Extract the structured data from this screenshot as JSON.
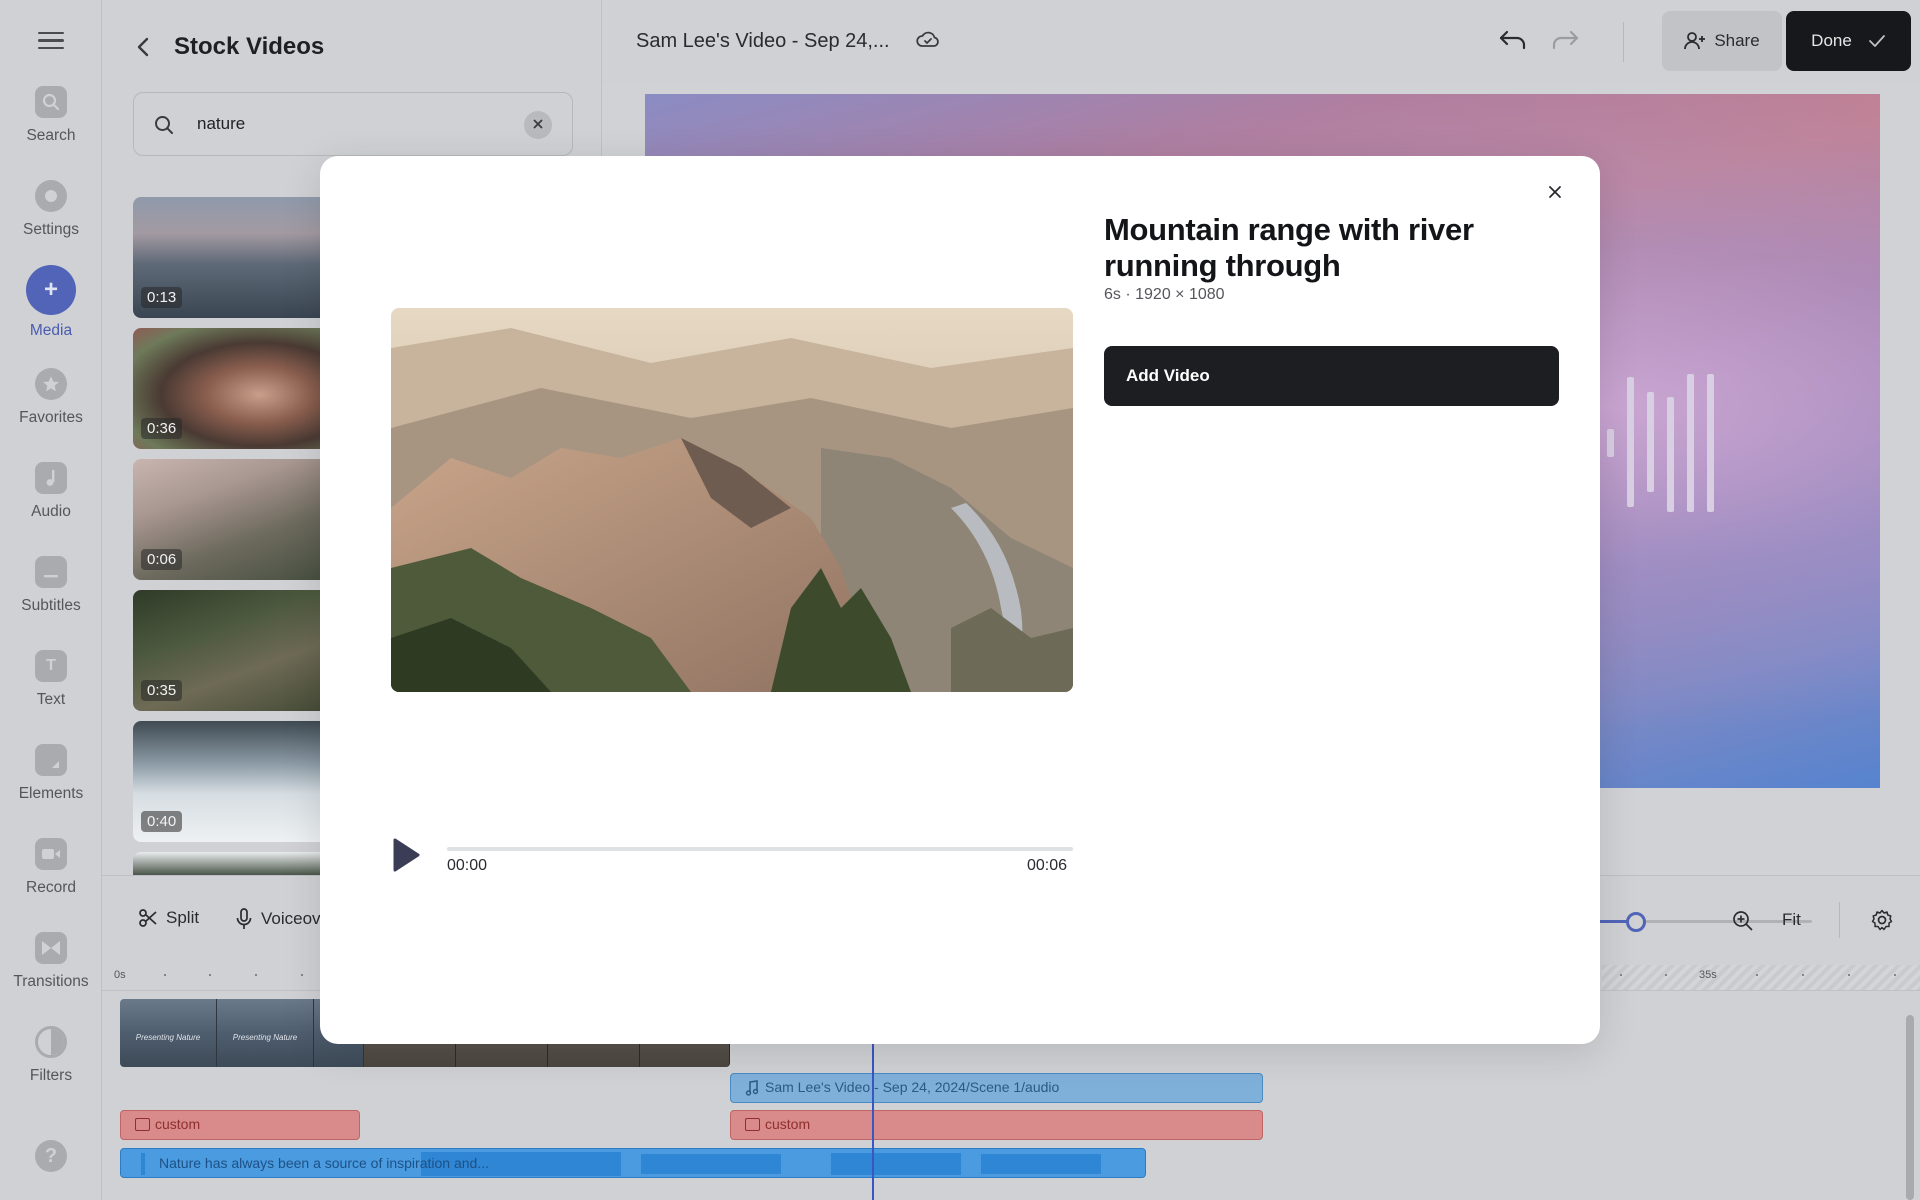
{
  "rail": {
    "items": [
      {
        "label": "Search",
        "icon": "search-icon"
      },
      {
        "label": "Settings",
        "icon": "gear-icon"
      },
      {
        "label": "Media",
        "icon": "plus-icon",
        "active": true
      },
      {
        "label": "Favorites",
        "icon": "star-icon"
      },
      {
        "label": "Audio",
        "icon": "music-note-icon"
      },
      {
        "label": "Subtitles",
        "icon": "subtitles-icon"
      },
      {
        "label": "Text",
        "icon": "text-icon"
      },
      {
        "label": "Elements",
        "icon": "elements-icon"
      },
      {
        "label": "Record",
        "icon": "record-icon"
      },
      {
        "label": "Transitions",
        "icon": "transitions-icon"
      },
      {
        "label": "Filters",
        "icon": "filters-icon"
      }
    ],
    "text_glyph": "T",
    "help_glyph": "?",
    "media_glyph": "+"
  },
  "panel": {
    "title": "Stock Videos",
    "search_value": "nature",
    "thumbnails": [
      {
        "duration": "0:13"
      },
      {
        "duration": "0:36"
      },
      {
        "duration": "0:06"
      },
      {
        "duration": "0:35"
      },
      {
        "duration": "0:40"
      }
    ]
  },
  "topbar": {
    "project_title": "Sam Lee's Video - Sep 24,...",
    "share_label": "Share",
    "done_label": "Done"
  },
  "toolbar": {
    "split_label": "Split",
    "voiceover_label": "Voiceov",
    "fit_label": "Fit",
    "zoom_level": 0.2
  },
  "timeline": {
    "ruler_start": "0s",
    "ruler_end": "35s",
    "video_caption": "Presenting Nature",
    "audio_clip_label": "Sam Lee's Video - Sep 24, 2024/Scene 1/audio",
    "custom_label": "custom",
    "voice_clip_label": "Nature has always been a source of inspiration and..."
  },
  "modal": {
    "title": "Mountain range with river running through",
    "meta": "6s · 1920 × 1080",
    "add_button": "Add Video",
    "time_current": "00:00",
    "time_total": "00:06",
    "progress": 0
  }
}
